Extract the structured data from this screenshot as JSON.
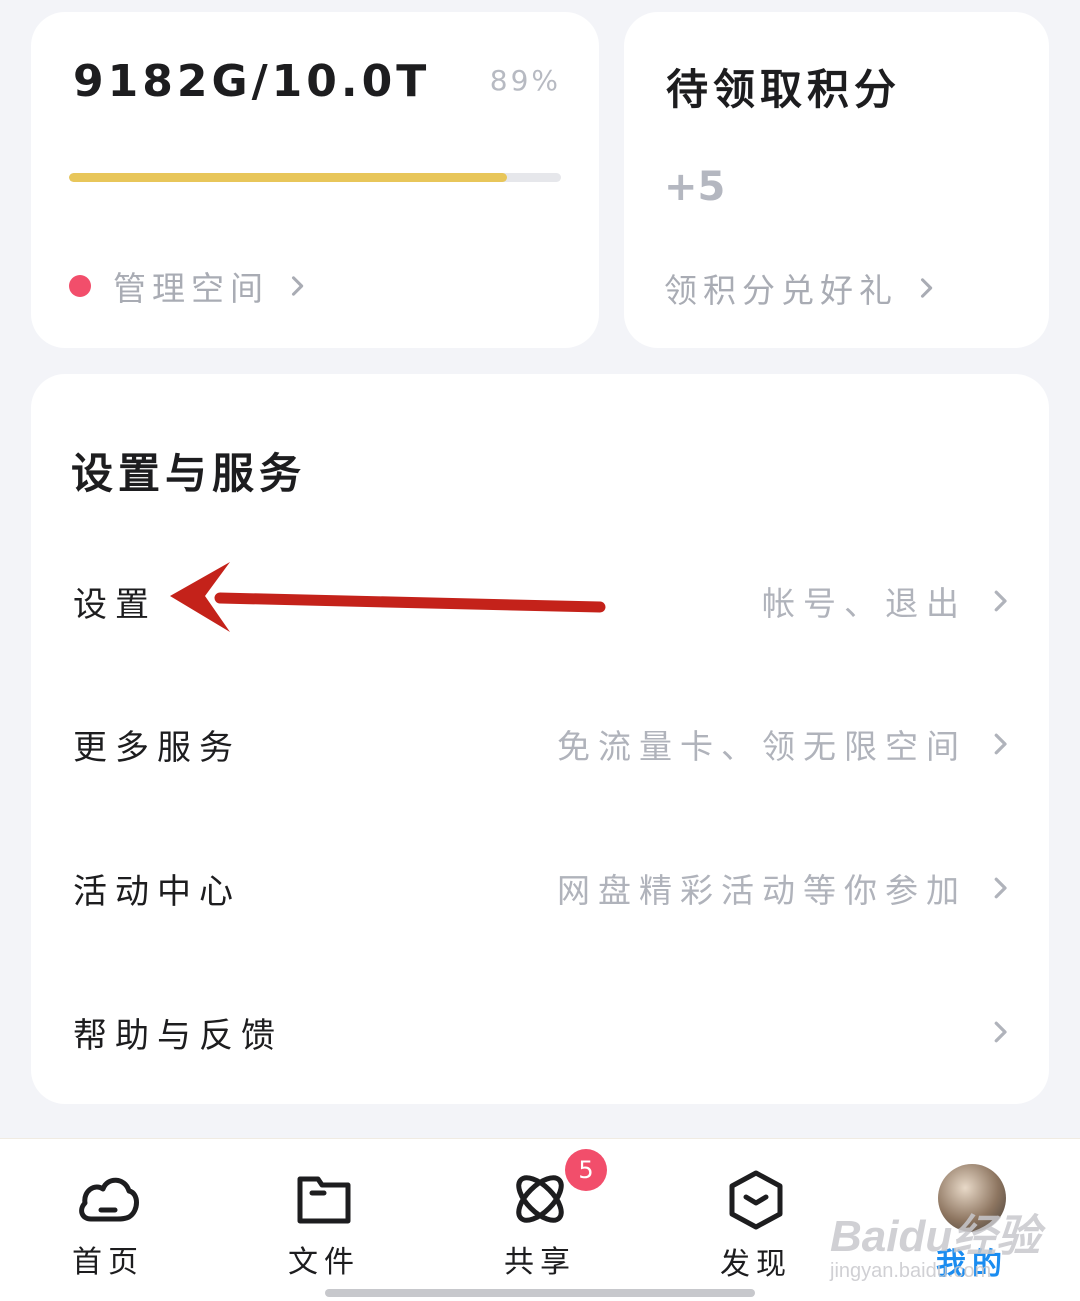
{
  "storage": {
    "used_text": "9182G/10.0T",
    "percent_text": "89%",
    "progress_fraction": 0.89,
    "manage_label": "管理空间"
  },
  "points": {
    "title": "待领取积分",
    "value": "+5",
    "link_label": "领积分兑好礼"
  },
  "settings": {
    "title": "设置与服务",
    "items": [
      {
        "label": "设置",
        "desc": "帐号、退出"
      },
      {
        "label": "更多服务",
        "desc": "免流量卡、领无限空间"
      },
      {
        "label": "活动中心",
        "desc": "网盘精彩活动等你参加"
      },
      {
        "label": "帮助与反馈",
        "desc": ""
      }
    ]
  },
  "tabbar": {
    "tabs": [
      {
        "label": "首页",
        "icon": "cloud-icon"
      },
      {
        "label": "文件",
        "icon": "folder-icon"
      },
      {
        "label": "共享",
        "icon": "orbit-icon"
      },
      {
        "label": "发现",
        "icon": "discover-icon"
      },
      {
        "label": "我的",
        "icon": "avatar"
      }
    ],
    "share_badge": "5",
    "active_color": "#1a8cf0"
  },
  "watermark": {
    "logo": "Baidu经验",
    "url": "jingyan.baidu.com"
  },
  "colors": {
    "progress": "#e8c65a",
    "dot": "#f24e6b",
    "annotation_arrow": "#c4221a"
  }
}
